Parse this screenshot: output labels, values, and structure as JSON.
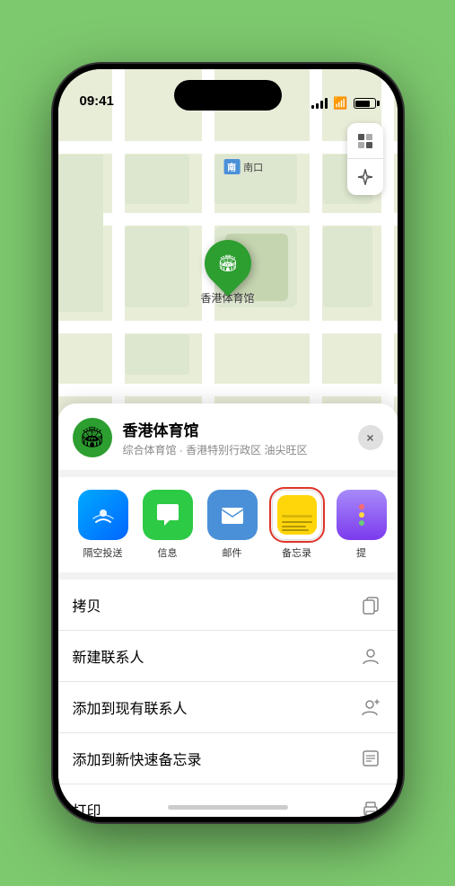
{
  "status": {
    "time": "09:41",
    "location_arrow": "▲"
  },
  "map": {
    "south_gate_label": "南口",
    "south_gate_prefix": "南口",
    "venue_name_map": "香港体育馆"
  },
  "venue": {
    "name": "香港体育馆",
    "subtitle": "综合体育馆 · 香港特别行政区 油尖旺区",
    "close_label": "×"
  },
  "share_items": [
    {
      "id": "airdrop",
      "label": "隔空投送",
      "type": "airdrop"
    },
    {
      "id": "message",
      "label": "信息",
      "type": "message"
    },
    {
      "id": "mail",
      "label": "邮件",
      "type": "mail"
    },
    {
      "id": "notes",
      "label": "备忘录",
      "type": "notes",
      "selected": true
    },
    {
      "id": "more",
      "label": "提",
      "type": "more"
    }
  ],
  "actions": [
    {
      "id": "copy",
      "label": "拷贝",
      "icon": "copy"
    },
    {
      "id": "new-contact",
      "label": "新建联系人",
      "icon": "person-add"
    },
    {
      "id": "add-existing",
      "label": "添加到现有联系人",
      "icon": "person-plus"
    },
    {
      "id": "quick-note",
      "label": "添加到新快速备忘录",
      "icon": "note"
    },
    {
      "id": "print",
      "label": "打印",
      "icon": "printer"
    }
  ]
}
